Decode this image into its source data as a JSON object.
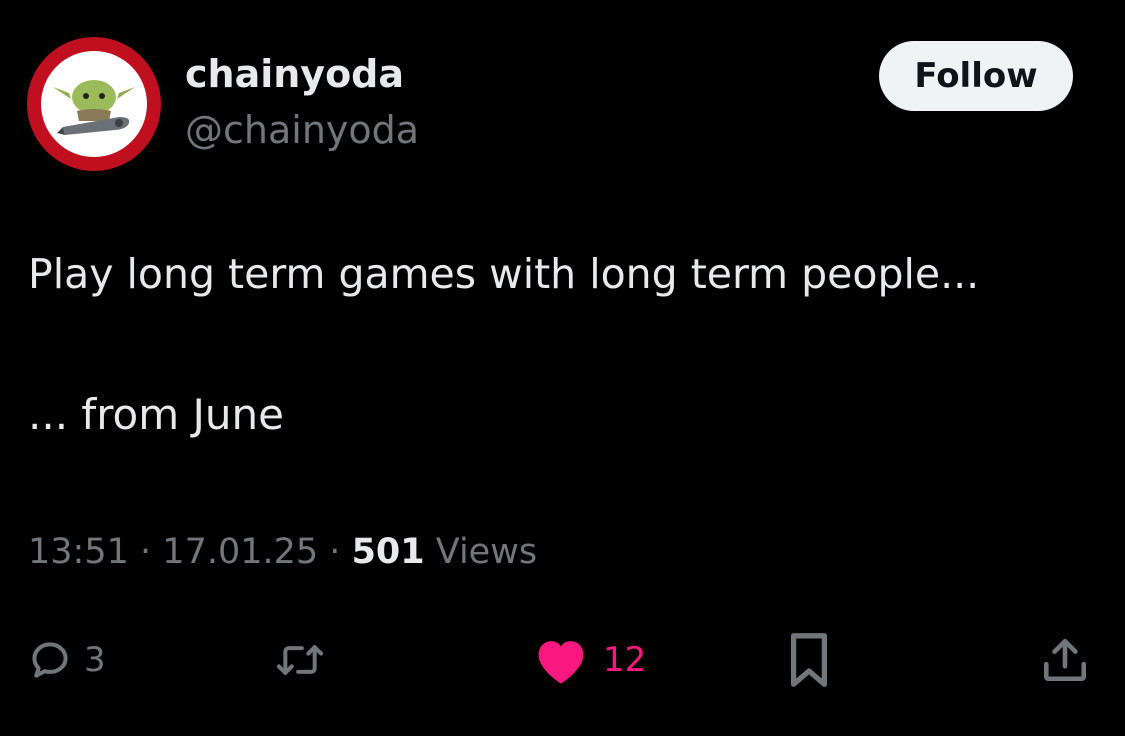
{
  "author": {
    "display_name": "chainyoda",
    "handle": "@chainyoda",
    "avatar_icon": "yoda-avatar-icon",
    "avatar_ring_color": "#c0101f"
  },
  "follow_button": {
    "label": "Follow"
  },
  "tweet": {
    "line1": "Play long term games with long term people...",
    "line2": "... from June"
  },
  "meta": {
    "time": "13:51",
    "sep1": "·",
    "date": "17.01.25",
    "sep2": "·",
    "views_count": "501",
    "views_label": "Views"
  },
  "actions": {
    "reply_count": "3",
    "like_count": "12",
    "like_color": "#f91880",
    "icons": [
      "reply-icon",
      "retweet-icon",
      "heart-icon",
      "bookmark-icon",
      "share-icon"
    ]
  }
}
